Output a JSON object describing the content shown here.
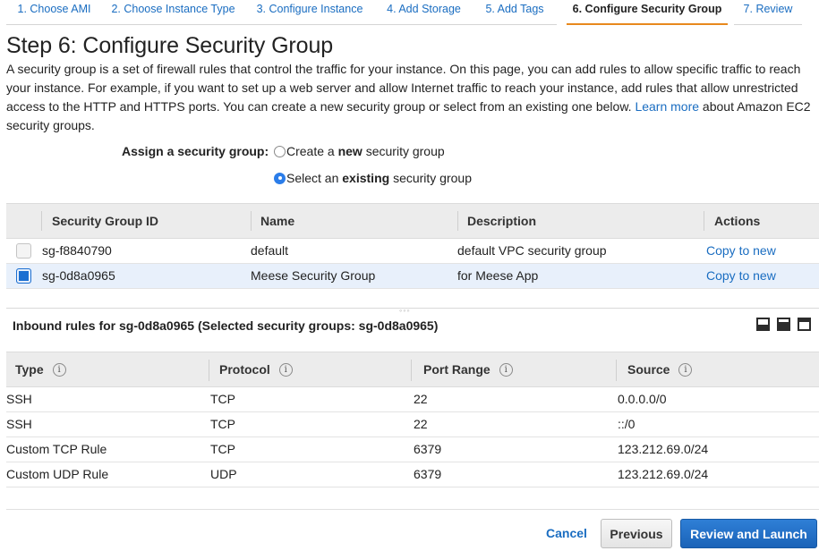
{
  "wizard": {
    "tabs": [
      {
        "label": "1. Choose AMI"
      },
      {
        "label": "2. Choose Instance Type"
      },
      {
        "label": "3. Configure Instance"
      },
      {
        "label": "4. Add Storage"
      },
      {
        "label": "5. Add Tags"
      },
      {
        "label": "6. Configure Security Group",
        "active": true
      },
      {
        "label": "7. Review"
      }
    ]
  },
  "page": {
    "title": "Step 6: Configure Security Group",
    "description": "A security group is a set of firewall rules that control the traffic for your instance. On this page, you can add rules to allow specific traffic to reach your instance. For example, if you want to set up a web server and allow Internet traffic to reach your instance, add rules that allow unrestricted access to the HTTP and HTTPS ports. You can create a new security group or select from an existing one below.",
    "learn_more": "Learn more",
    "description_tail": "about Amazon EC2 security groups."
  },
  "assign": {
    "label": "Assign a security group:",
    "option_new": {
      "prefix": "Create a ",
      "bold": "new",
      "suffix": " security group",
      "checked": false
    },
    "option_existing": {
      "prefix": "Select an ",
      "bold": "existing",
      "suffix": " security group",
      "checked": true
    }
  },
  "security_groups": {
    "columns": [
      "Security Group ID",
      "Name",
      "Description",
      "Actions"
    ],
    "rows": [
      {
        "id": "sg-f8840790",
        "name": "default",
        "description": "default VPC security group",
        "action": "Copy to new",
        "selected": false
      },
      {
        "id": "sg-0d8a0965",
        "name": "Meese Security Group",
        "description": "for Meese App",
        "action": "Copy to new",
        "selected": true
      }
    ]
  },
  "inbound": {
    "title": "Inbound rules for sg-0d8a0965 (Selected security groups: sg-0d8a0965)",
    "columns": [
      "Type",
      "Protocol",
      "Port Range",
      "Source"
    ],
    "rows": [
      {
        "type": "SSH",
        "protocol": "TCP",
        "port": "22",
        "source": "0.0.0.0/0"
      },
      {
        "type": "SSH",
        "protocol": "TCP",
        "port": "22",
        "source": "::/0"
      },
      {
        "type": "Custom TCP Rule",
        "protocol": "TCP",
        "port": "6379",
        "source": "123.212.69.0/24"
      },
      {
        "type": "Custom UDP Rule",
        "protocol": "UDP",
        "port": "6379",
        "source": "123.212.69.0/24"
      }
    ]
  },
  "footer": {
    "cancel": "Cancel",
    "previous": "Previous",
    "review_launch": "Review and Launch"
  }
}
